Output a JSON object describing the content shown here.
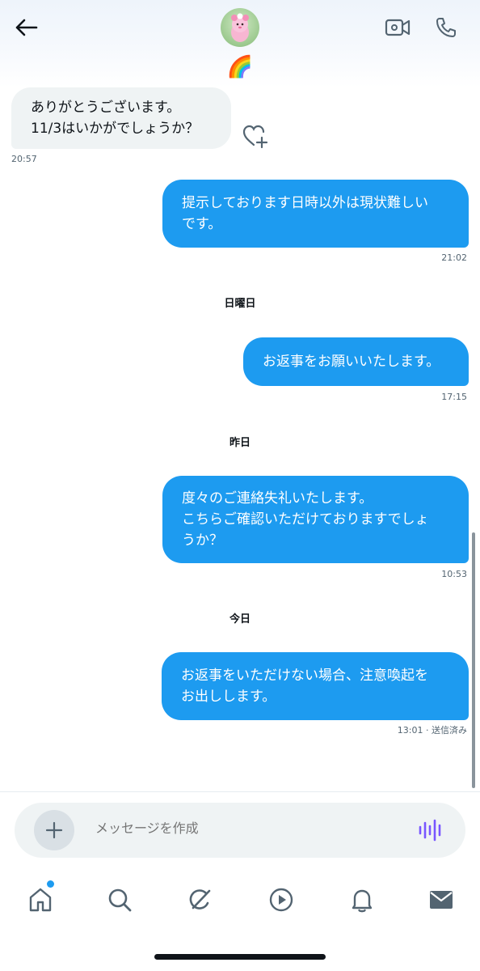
{
  "header": {
    "avatar_badge_emoji": "🌈"
  },
  "messages": [
    {
      "direction": "in",
      "text": "ありがとうございます。\n11/3はいかがでしょうか？",
      "time": "20:57"
    },
    {
      "direction": "out",
      "text": "提示しております日時以外は現状難しい\nです。",
      "time": "21:02"
    },
    {
      "divider": "日曜日"
    },
    {
      "direction": "out",
      "text": "お返事をお願いいたします。",
      "time": "17:15"
    },
    {
      "divider": "昨日"
    },
    {
      "direction": "out",
      "text": "度々のご連絡失礼いたします。\nこちらご確認いただけておりますでしょ\nうか？",
      "time": "10:53"
    },
    {
      "divider": "今日"
    },
    {
      "direction": "out",
      "text": "お返事をいただけない場合、注意喚起を\nお出しします。",
      "time": "13:01 · 送信済み"
    }
  ],
  "composer": {
    "placeholder": "メッセージを作成"
  },
  "icons": {
    "back": "arrow-left-icon",
    "video": "video-call-icon",
    "call": "phone-icon",
    "react": "heart-plus-icon",
    "add": "plus-icon",
    "voice": "audio-wave-icon",
    "nav": [
      "home-icon",
      "search-icon",
      "grok-icon",
      "play-icon",
      "bell-icon",
      "mail-icon"
    ]
  },
  "colors": {
    "outgoing_bubble": "#1d9bf0",
    "incoming_bubble": "#eff3f4",
    "voice_accent": "#7856ff",
    "notification_dot": "#1d9bf0"
  }
}
